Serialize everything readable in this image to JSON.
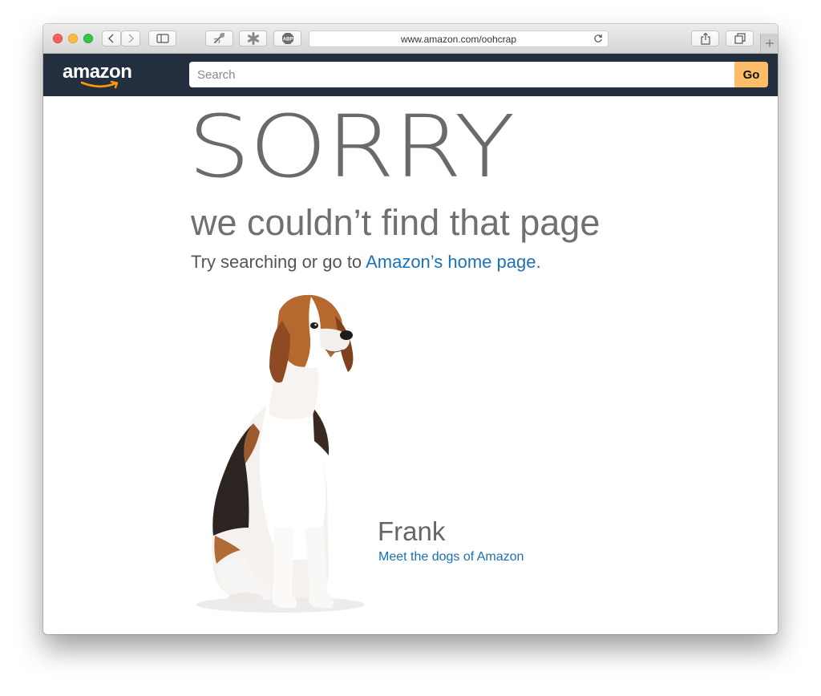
{
  "browser": {
    "url": "www.amazon.com/oohcrap",
    "accent": "#232f3e"
  },
  "header": {
    "logo_text": "amazon",
    "search": {
      "placeholder": "Search",
      "value": ""
    },
    "go_label": "Go",
    "go_color": "#febd69"
  },
  "content": {
    "headline": "SORRY",
    "subhead": "we couldn’t find that page",
    "try_prefix": "Try searching or go to ",
    "home_link": "Amazon’s home page",
    "try_suffix": ".",
    "dog_name": "Frank",
    "dogs_link": "Meet the dogs of Amazon",
    "link_color": "#1a73b9"
  }
}
